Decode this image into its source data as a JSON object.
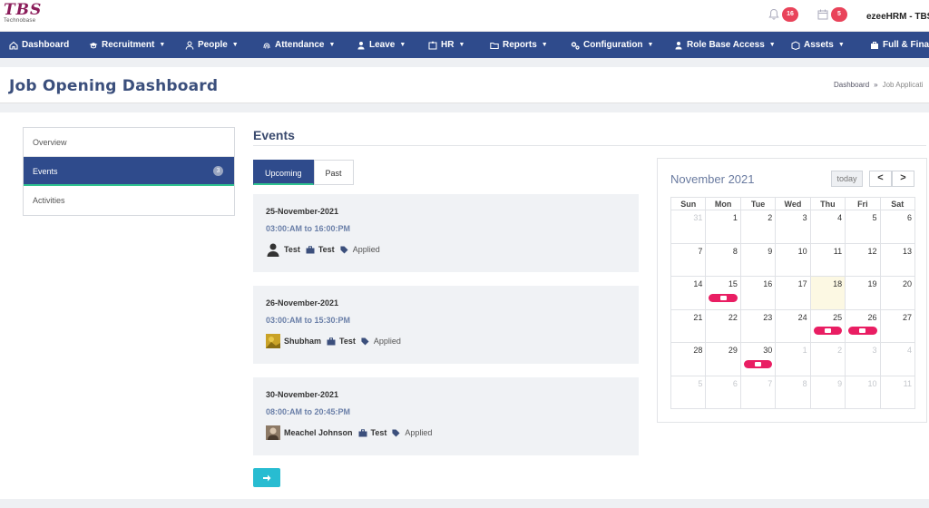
{
  "brand": {
    "logo_text": "TBS",
    "logo_sub": "Technobase"
  },
  "header": {
    "notifications_count": "16",
    "tasks_count": "5",
    "user_name": "ezeeHRM - TBS"
  },
  "nav": [
    {
      "label": "Dashboard",
      "icon": "home-icon"
    },
    {
      "label": "Recruitment",
      "icon": "graduation-icon"
    },
    {
      "label": "People",
      "icon": "user-icon"
    },
    {
      "label": "Attendance",
      "icon": "fingerprint-icon"
    },
    {
      "label": "Leave",
      "icon": "leave-icon"
    },
    {
      "label": "HR",
      "icon": "id-card-icon"
    },
    {
      "label": "Reports",
      "icon": "folder-icon"
    },
    {
      "label": "Configuration",
      "icon": "gears-icon"
    },
    {
      "label": "Role Base Access",
      "icon": "shield-icon"
    },
    {
      "label": "Assets",
      "icon": "assets-icon"
    },
    {
      "label": "Full & Final",
      "icon": "briefcase-icon"
    }
  ],
  "page": {
    "title": "Job Opening Dashboard",
    "breadcrumb_home": "Dashboard",
    "breadcrumb_current": "Job Applicati"
  },
  "sidebar": {
    "items": [
      {
        "label": "Overview"
      },
      {
        "label": "Events",
        "count": "3"
      },
      {
        "label": "Activities"
      }
    ]
  },
  "events": {
    "title": "Events",
    "tabs": [
      "Upcoming",
      "Past"
    ],
    "items": [
      {
        "date": "25-November-2021",
        "time": "03:00:AM to 16:00:PM",
        "name": "Test",
        "job": "Test",
        "status": "Applied"
      },
      {
        "date": "26-November-2021",
        "time": "03:00:AM to 15:30:PM",
        "name": "Shubham",
        "job": "Test",
        "status": "Applied"
      },
      {
        "date": "30-November-2021",
        "time": "08:00:AM to 20:45:PM",
        "name": "Meachel Johnson",
        "job": "Test",
        "status": "Applied"
      }
    ]
  },
  "calendar": {
    "title": "November 2021",
    "today_label": "today",
    "prev": "<",
    "next": ">",
    "weekdays": [
      "Sun",
      "Mon",
      "Tue",
      "Wed",
      "Thu",
      "Fri",
      "Sat"
    ],
    "weeks": [
      [
        "31",
        "1",
        "2",
        "3",
        "4",
        "5",
        "6"
      ],
      [
        "7",
        "8",
        "9",
        "10",
        "11",
        "12",
        "13"
      ],
      [
        "14",
        "15",
        "16",
        "17",
        "18",
        "19",
        "20"
      ],
      [
        "21",
        "22",
        "23",
        "24",
        "25",
        "26",
        "27"
      ],
      [
        "28",
        "29",
        "30",
        "1",
        "2",
        "3",
        "4"
      ],
      [
        "5",
        "6",
        "7",
        "8",
        "9",
        "10",
        "11"
      ]
    ]
  }
}
